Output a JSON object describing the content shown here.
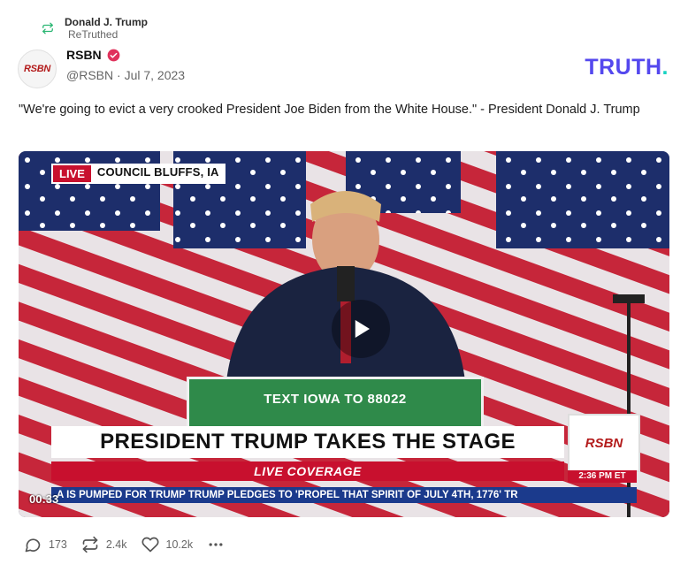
{
  "retruth": {
    "user": "Donald J. Trump",
    "action": "ReTruthed"
  },
  "author": {
    "name": "RSBN",
    "handle": "@RSBN",
    "date": "Jul 7, 2023",
    "avatar_text": "RSBN"
  },
  "brand": {
    "text": "TRUTH",
    "dot": "."
  },
  "post": {
    "text": "\"We're going to evict a very crooked President Joe Biden from the White House.\" - President Donald J. Trump"
  },
  "video": {
    "duration": "00:33",
    "live_label": "LIVE",
    "location": "COUNCIL BLUFFS, IA",
    "podium_text": "TEXT IOWA TO 88022",
    "headline": "PRESIDENT TRUMP TAKES THE STAGE",
    "live_coverage": "LIVE COVERAGE",
    "ticker": "A IS PUMPED FOR TRUMP    TRUMP PLEDGES TO 'PROPEL THAT SPIRIT OF JULY 4TH, 1776'    TR",
    "bug_text": "RSBN",
    "bug_time": "2:36 PM ET"
  },
  "actions": {
    "replies": "173",
    "retruths": "2.4k",
    "likes": "10.2k"
  },
  "colors": {
    "brand": "#5448ee",
    "brand_dot": "#17d3c2",
    "verified": "#e0325c",
    "retruth_icon": "#2bb673"
  }
}
